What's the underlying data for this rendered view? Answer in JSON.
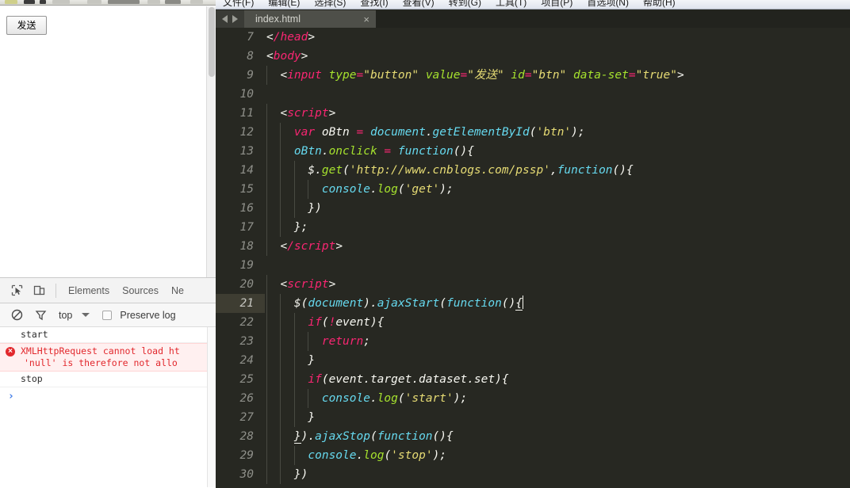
{
  "browser": {
    "send_button_label": "发送",
    "scrollbar_name": "page-scrollbar"
  },
  "devtools": {
    "inspect_icon": "inspect-element-icon",
    "device_icon": "device-toolbar-icon",
    "tabs": [
      {
        "label": "Elements",
        "active": false
      },
      {
        "label": "Sources",
        "active": false
      },
      {
        "label": "Ne",
        "active": false
      }
    ],
    "filterbar": {
      "clear_icon": "clear-console-icon",
      "filter_icon": "filter-icon",
      "context_value": "top",
      "caret_icon": "chevron-down-icon",
      "preserve_log_label": "Preserve log",
      "preserve_log_checked": false
    },
    "console": {
      "rows": [
        {
          "type": "log",
          "text": "start"
        },
        {
          "type": "error",
          "line1": "XMLHttpRequest cannot load ht",
          "line2": "'null' is therefore not allo",
          "badge": "×"
        },
        {
          "type": "log",
          "text": "stop"
        }
      ],
      "prompt_symbol": "›"
    }
  },
  "editor": {
    "menu": [
      "文件(F)",
      "编辑(E)",
      "选择(S)",
      "查找(I)",
      "查看(V)",
      "转到(G)",
      "工具(T)",
      "项目(P)",
      "首选项(N)",
      "帮助(H)"
    ],
    "nav_prev_icon": "arrow-left-icon",
    "nav_next_icon": "arrow-right-icon",
    "tab_label": "index.html",
    "tab_close": "×",
    "active_line": 21,
    "lines": [
      {
        "n": "7",
        "indent": 0,
        "tokens": [
          {
            "c": "t-punc",
            "v": "<"
          },
          {
            "c": "t-tag",
            "v": "/head"
          },
          {
            "c": "t-punc",
            "v": ">"
          }
        ]
      },
      {
        "n": "8",
        "indent": 0,
        "tokens": [
          {
            "c": "t-punc",
            "v": "<"
          },
          {
            "c": "t-tag",
            "v": "body"
          },
          {
            "c": "t-punc",
            "v": ">"
          }
        ]
      },
      {
        "n": "9",
        "indent": 1,
        "tokens": [
          {
            "c": "t-punc",
            "v": "  <"
          },
          {
            "c": "t-tag",
            "v": "input"
          },
          {
            "c": "t-plain",
            "v": " "
          },
          {
            "c": "t-attr",
            "v": "type"
          },
          {
            "c": "t-op",
            "v": "="
          },
          {
            "c": "t-str",
            "v": "\"button\""
          },
          {
            "c": "t-plain",
            "v": " "
          },
          {
            "c": "t-attr",
            "v": "value"
          },
          {
            "c": "t-op",
            "v": "="
          },
          {
            "c": "t-str",
            "v": "\"发送\""
          },
          {
            "c": "t-plain",
            "v": " "
          },
          {
            "c": "t-attr",
            "v": "id"
          },
          {
            "c": "t-op",
            "v": "="
          },
          {
            "c": "t-str",
            "v": "\"btn\""
          },
          {
            "c": "t-plain",
            "v": " "
          },
          {
            "c": "t-attr",
            "v": "data-set"
          },
          {
            "c": "t-op",
            "v": "="
          },
          {
            "c": "t-str",
            "v": "\"true\""
          },
          {
            "c": "t-punc",
            "v": ">"
          }
        ]
      },
      {
        "n": "10",
        "indent": 0,
        "tokens": []
      },
      {
        "n": "11",
        "indent": 1,
        "tokens": [
          {
            "c": "t-punc",
            "v": "  <"
          },
          {
            "c": "t-tag",
            "v": "script"
          },
          {
            "c": "t-punc",
            "v": ">"
          }
        ]
      },
      {
        "n": "12",
        "indent": 2,
        "tokens": [
          {
            "c": "t-kw",
            "v": "    var"
          },
          {
            "c": "t-plain",
            "v": " "
          },
          {
            "c": "t-var",
            "v": "oBtn"
          },
          {
            "c": "t-plain",
            "v": " "
          },
          {
            "c": "t-op",
            "v": "="
          },
          {
            "c": "t-plain",
            "v": " "
          },
          {
            "c": "t-ident",
            "v": "document"
          },
          {
            "c": "t-plain",
            "v": "."
          },
          {
            "c": "t-ident",
            "v": "getElementById"
          },
          {
            "c": "t-plain",
            "v": "("
          },
          {
            "c": "t-str",
            "v": "'btn'"
          },
          {
            "c": "t-plain",
            "v": ");"
          }
        ]
      },
      {
        "n": "13",
        "indent": 2,
        "tokens": [
          {
            "c": "t-plain",
            "v": "    "
          },
          {
            "c": "t-ident",
            "v": "oBtn"
          },
          {
            "c": "t-plain",
            "v": "."
          },
          {
            "c": "t-prop",
            "v": "onclick"
          },
          {
            "c": "t-plain",
            "v": " "
          },
          {
            "c": "t-op",
            "v": "="
          },
          {
            "c": "t-plain",
            "v": " "
          },
          {
            "c": "t-ident",
            "v": "function"
          },
          {
            "c": "t-plain",
            "v": "(){"
          }
        ]
      },
      {
        "n": "14",
        "indent": 3,
        "tokens": [
          {
            "c": "t-plain",
            "v": "      "
          },
          {
            "c": "t-var",
            "v": "$"
          },
          {
            "c": "t-plain",
            "v": "."
          },
          {
            "c": "t-prop",
            "v": "get"
          },
          {
            "c": "t-plain",
            "v": "("
          },
          {
            "c": "t-str",
            "v": "'http://www.cnblogs.com/pssp'"
          },
          {
            "c": "t-plain",
            "v": ","
          },
          {
            "c": "t-ident",
            "v": "function"
          },
          {
            "c": "t-plain",
            "v": "(){"
          }
        ]
      },
      {
        "n": "15",
        "indent": 4,
        "tokens": [
          {
            "c": "t-plain",
            "v": "        "
          },
          {
            "c": "t-ident",
            "v": "console"
          },
          {
            "c": "t-plain",
            "v": "."
          },
          {
            "c": "t-prop",
            "v": "log"
          },
          {
            "c": "t-plain",
            "v": "("
          },
          {
            "c": "t-str",
            "v": "'get'"
          },
          {
            "c": "t-plain",
            "v": ");"
          }
        ]
      },
      {
        "n": "16",
        "indent": 3,
        "tokens": [
          {
            "c": "t-plain",
            "v": "      })"
          }
        ]
      },
      {
        "n": "17",
        "indent": 2,
        "tokens": [
          {
            "c": "t-plain",
            "v": "    };"
          }
        ]
      },
      {
        "n": "18",
        "indent": 1,
        "tokens": [
          {
            "c": "t-punc",
            "v": "  <"
          },
          {
            "c": "t-tag",
            "v": "/script"
          },
          {
            "c": "t-punc",
            "v": ">"
          }
        ]
      },
      {
        "n": "19",
        "indent": 0,
        "tokens": []
      },
      {
        "n": "20",
        "indent": 1,
        "tokens": [
          {
            "c": "t-punc",
            "v": "  <"
          },
          {
            "c": "t-tag",
            "v": "script"
          },
          {
            "c": "t-punc",
            "v": ">"
          }
        ]
      },
      {
        "n": "21",
        "indent": 2,
        "active": true,
        "tokens": [
          {
            "c": "t-plain",
            "v": "    "
          },
          {
            "c": "t-var",
            "v": "$"
          },
          {
            "c": "t-plain",
            "v": "("
          },
          {
            "c": "t-ident",
            "v": "document"
          },
          {
            "c": "t-plain",
            "v": ")."
          },
          {
            "c": "t-ident",
            "v": "ajaxStart"
          },
          {
            "c": "t-plain",
            "v": "("
          },
          {
            "c": "t-ident",
            "v": "function"
          },
          {
            "c": "t-plain",
            "v": "()"
          },
          {
            "c": "t-plain ulbrace",
            "v": "{"
          },
          {
            "c": "caret",
            "v": ""
          }
        ]
      },
      {
        "n": "22",
        "indent": 3,
        "tokens": [
          {
            "c": "t-kw",
            "v": "      if"
          },
          {
            "c": "t-plain",
            "v": "("
          },
          {
            "c": "t-op",
            "v": "!"
          },
          {
            "c": "t-plain",
            "v": "event){"
          }
        ]
      },
      {
        "n": "23",
        "indent": 4,
        "tokens": [
          {
            "c": "t-kw",
            "v": "        return"
          },
          {
            "c": "t-plain",
            "v": ";"
          }
        ]
      },
      {
        "n": "24",
        "indent": 3,
        "tokens": [
          {
            "c": "t-plain",
            "v": "      }"
          }
        ]
      },
      {
        "n": "25",
        "indent": 3,
        "tokens": [
          {
            "c": "t-kw",
            "v": "      if"
          },
          {
            "c": "t-plain",
            "v": "(event.target.dataset.set){"
          }
        ]
      },
      {
        "n": "26",
        "indent": 4,
        "tokens": [
          {
            "c": "t-plain",
            "v": "        "
          },
          {
            "c": "t-ident",
            "v": "console"
          },
          {
            "c": "t-plain",
            "v": "."
          },
          {
            "c": "t-prop",
            "v": "log"
          },
          {
            "c": "t-plain",
            "v": "("
          },
          {
            "c": "t-str",
            "v": "'start'"
          },
          {
            "c": "t-plain",
            "v": ");"
          }
        ]
      },
      {
        "n": "27",
        "indent": 3,
        "tokens": [
          {
            "c": "t-plain",
            "v": "      }"
          }
        ]
      },
      {
        "n": "28",
        "indent": 2,
        "tokens": [
          {
            "c": "t-plain",
            "v": "    "
          },
          {
            "c": "t-plain ulbrace",
            "v": "}"
          },
          {
            "c": "t-plain",
            "v": ")."
          },
          {
            "c": "t-ident",
            "v": "ajaxStop"
          },
          {
            "c": "t-plain",
            "v": "("
          },
          {
            "c": "t-ident",
            "v": "function"
          },
          {
            "c": "t-plain",
            "v": "(){"
          }
        ]
      },
      {
        "n": "29",
        "indent": 3,
        "tokens": [
          {
            "c": "t-plain",
            "v": "      "
          },
          {
            "c": "t-ident",
            "v": "console"
          },
          {
            "c": "t-plain",
            "v": "."
          },
          {
            "c": "t-prop",
            "v": "log"
          },
          {
            "c": "t-plain",
            "v": "("
          },
          {
            "c": "t-str",
            "v": "'stop'"
          },
          {
            "c": "t-plain",
            "v": ");"
          }
        ]
      },
      {
        "n": "30",
        "indent": 2,
        "tokens": [
          {
            "c": "t-plain",
            "v": "    })"
          }
        ]
      }
    ]
  },
  "colors": {
    "editor_bg": "#272822",
    "active_line_gutter": "#3e3d32",
    "tag": "#f92672",
    "attr": "#a6e22e",
    "string": "#e6db74",
    "ident": "#66d9ef",
    "plain": "#f8f8f2",
    "gutter_text": "#8f908a",
    "error_red": "#e2282d"
  }
}
